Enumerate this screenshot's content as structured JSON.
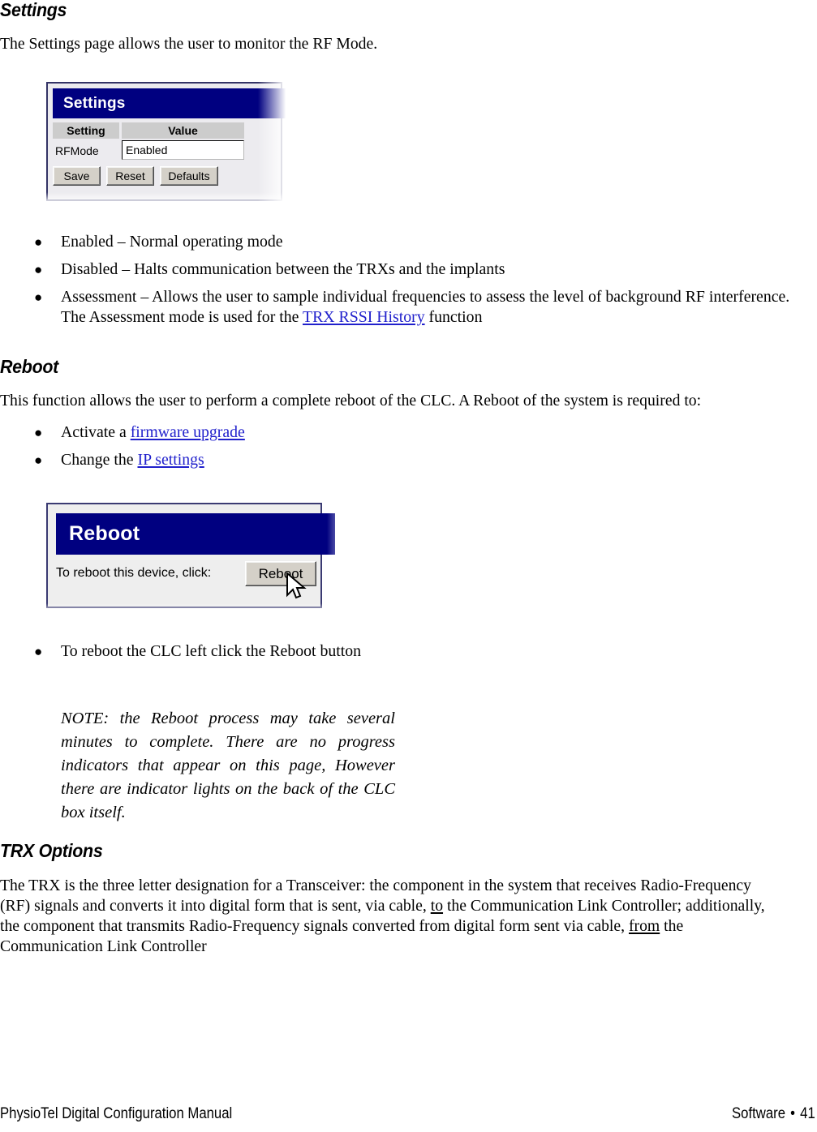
{
  "document": {
    "sections": [
      {
        "heading": "Settings",
        "intro": "The Settings page allows the user to monitor the RF Mode.",
        "bullets": [
          {
            "pre": "Enabled – Normal operating mode",
            "link": "",
            "post": ""
          },
          {
            "pre": "Disabled – Halts communication between the TRXs and the implants",
            "link": "",
            "post": ""
          },
          {
            "pre": "Assessment – Allows the user to sample individual frequencies to assess the level of background RF interference. The Assessment mode is used for the ",
            "link": "TRX RSSI History",
            "post": " function"
          }
        ]
      },
      {
        "heading": "Reboot",
        "intro": "This function allows the user to perform a complete reboot of the CLC. A Reboot of the system is required to:",
        "bullets": [
          {
            "pre": "Activate a ",
            "link": "firmware upgrade",
            "post": ""
          },
          {
            "pre": "Change the ",
            "link": "IP settings",
            "post": ""
          }
        ],
        "post_bullets": [
          {
            "pre": "To reboot the CLC left click the Reboot button",
            "link": "",
            "post": ""
          }
        ],
        "note": "NOTE: the Reboot process may take several minutes to complete.  There are no progress indicators that appear on this page, However there are indicator lights on the back of the CLC box itself."
      },
      {
        "heading": "TRX Options",
        "paragraph_parts": {
          "p1": "The TRX is the three letter designation for a Transceiver: the component in the system that receives Radio-Frequency (RF) signals and converts it into digital form that is sent, via cable, ",
          "u1": "to",
          "p2": " the Communication Link Controller; additionally, the component that transmits Radio-Frequency signals converted from digital form sent via cable, ",
          "u2": "from",
          "p3": " the Communication Link Controller"
        }
      }
    ]
  },
  "settings_widget": {
    "title": "Settings",
    "columns": [
      "Setting",
      "Value"
    ],
    "rows": [
      {
        "setting": "RFMode",
        "value": "Enabled"
      }
    ],
    "buttons": [
      "Save",
      "Reset",
      "Defaults"
    ],
    "titlebar_color": "#000080"
  },
  "reboot_widget": {
    "title": "Reboot",
    "prompt": "To reboot this device, click:",
    "button": "Reboot",
    "titlebar_color": "#000080"
  },
  "footer": {
    "left": "PhysioTel Digital Configuration Manual",
    "right_label": "Software",
    "separator": "•",
    "page_number": "41"
  },
  "colors": {
    "link": "#2020CC",
    "navy": "#000080",
    "frame_border": "#333366"
  }
}
